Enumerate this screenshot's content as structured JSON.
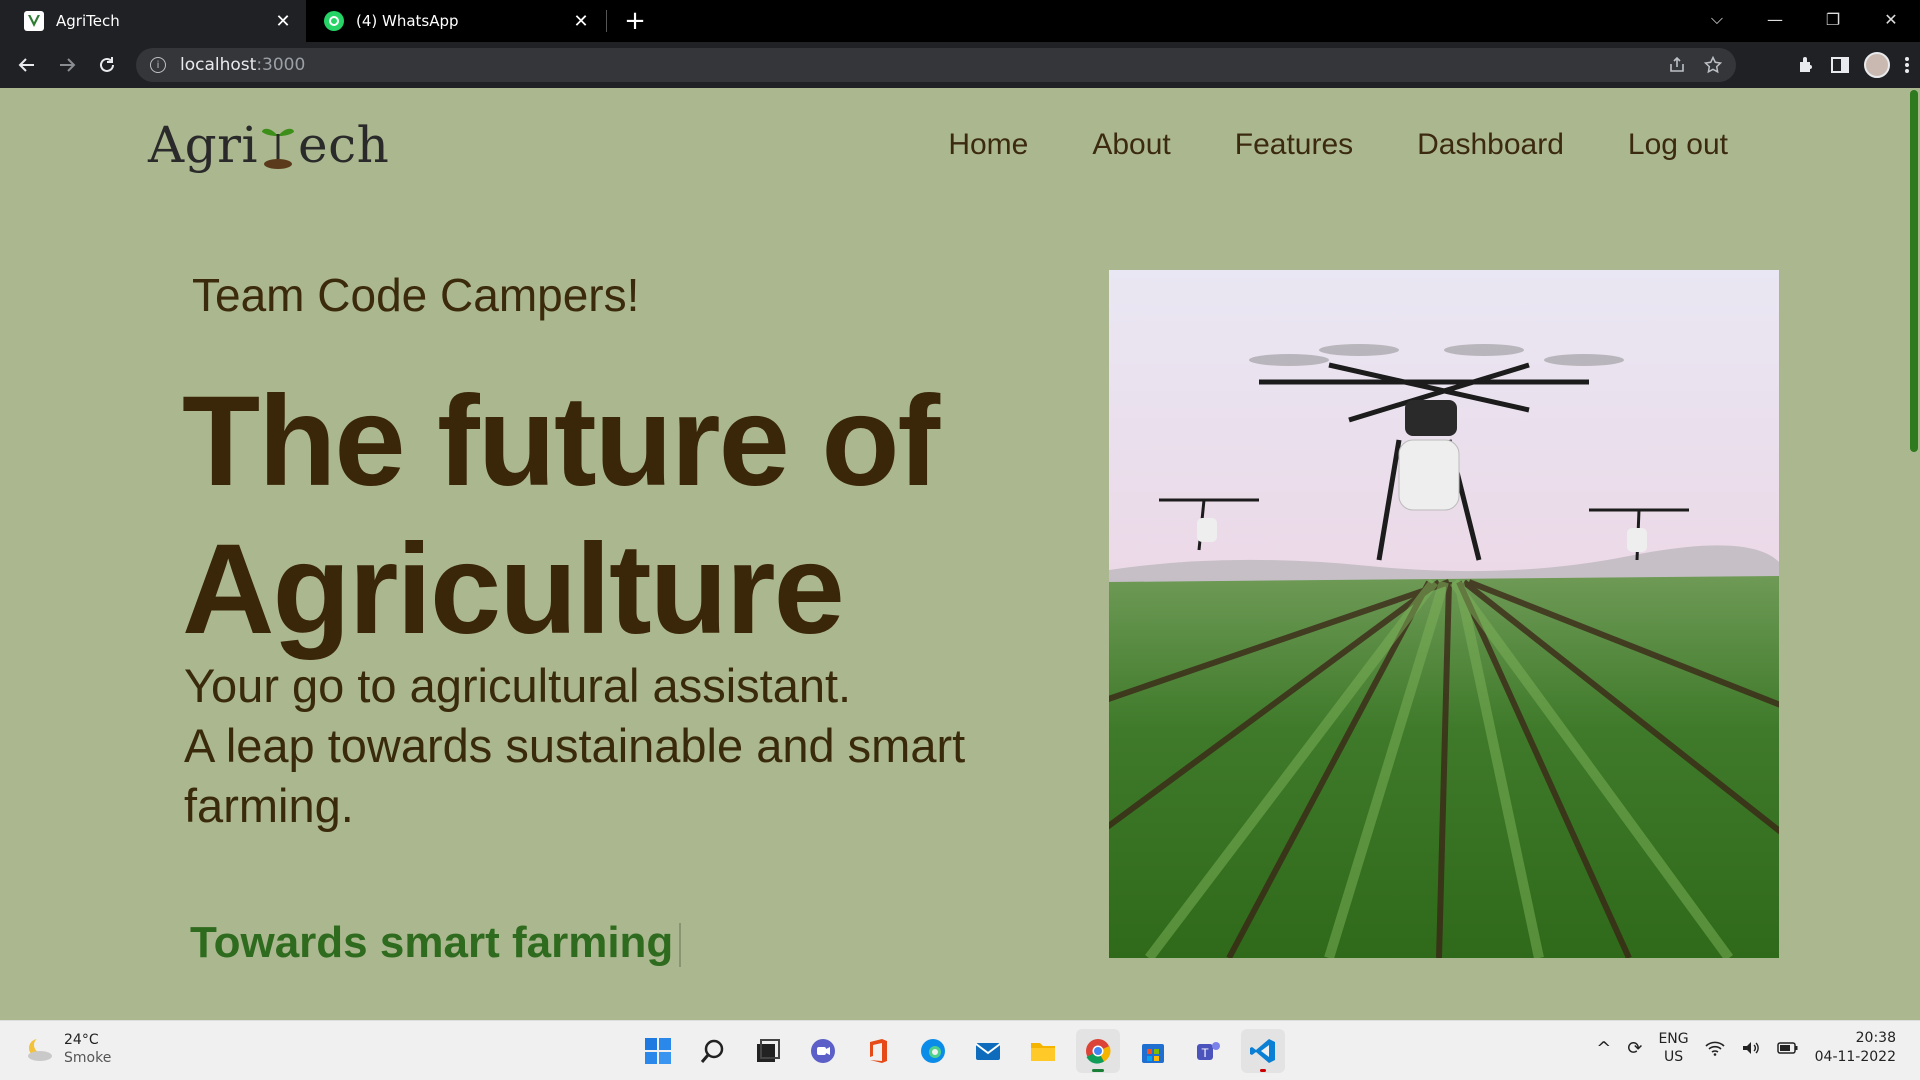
{
  "browser": {
    "tabs": [
      {
        "title": "AgriTech",
        "active": true,
        "icon": "agritech-favicon"
      },
      {
        "title": "(4) WhatsApp",
        "active": false,
        "icon": "whatsapp-favicon"
      }
    ],
    "new_tab": "+",
    "url_host": "localhost",
    "url_port": ":3000",
    "window_controls": {
      "dropdown": "⌵",
      "minimize": "—",
      "restore": "❐",
      "close": "✕"
    }
  },
  "site": {
    "logo_left": "Agri",
    "logo_right": "ech",
    "nav": [
      "Home",
      "About",
      "Features",
      "Dashboard",
      "Log out"
    ]
  },
  "hero": {
    "tagline": "Team Code Campers!",
    "headline_line1": "The future of",
    "headline_line2": "Agriculture",
    "sub_line1": "Your go to agricultural assistant.",
    "sub_line2": "A leap towards sustainable and smart farming.",
    "typing_text": "Towards smart farming",
    "image": "drones-over-farm-field"
  },
  "taskbar": {
    "weather_temp": "24°C",
    "weather_cond": "Smoke",
    "apps": [
      "start",
      "search",
      "task-view",
      "teams-chat",
      "office",
      "edge",
      "mail",
      "file-explorer",
      "chrome",
      "store",
      "teams",
      "vscode"
    ],
    "lang_top": "ENG",
    "lang_bottom": "US",
    "time": "20:38",
    "date": "04-11-2022"
  },
  "colors": {
    "page_bg": "#abb88f",
    "text_dark": "#3a2608",
    "accent_green": "#2e6b1e"
  }
}
